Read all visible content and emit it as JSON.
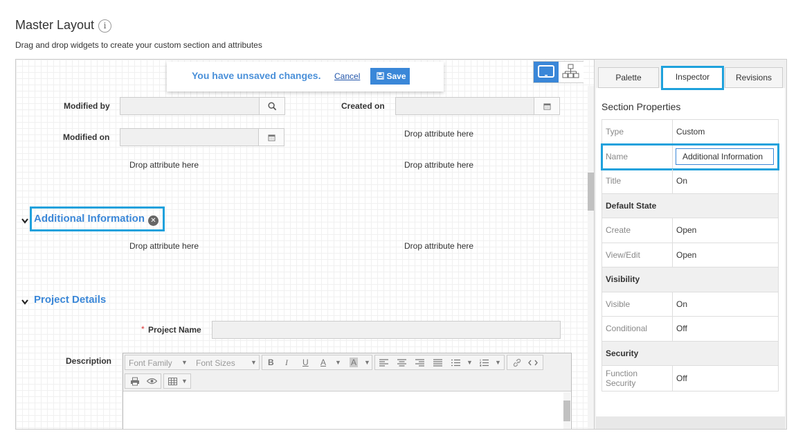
{
  "page": {
    "title": "Master Layout",
    "info_glyph": "i",
    "subtitle": "Drag and drop widgets to create your custom section and attributes"
  },
  "notice": {
    "message": "You have unsaved changes.",
    "cancel": "Cancel",
    "save": "Save"
  },
  "fields": {
    "modified_by": "Modified by",
    "created_on": "Created on",
    "modified_on": "Modified on",
    "drop_text": "Drop attribute here"
  },
  "sections": {
    "additional": "Additional Information",
    "project": "Project Details"
  },
  "project": {
    "required_mark": "*",
    "name_label": "Project Name",
    "description_label": "Description"
  },
  "editor": {
    "font_family": "Font Family",
    "font_sizes": "Font Sizes",
    "bold": "B",
    "italic": "I",
    "underline": "U",
    "font_color": "A",
    "bg_color": "A"
  },
  "panel": {
    "tabs": [
      {
        "label": "Palette"
      },
      {
        "label": "Inspector"
      },
      {
        "label": "Revisions"
      }
    ],
    "active_tab": "Inspector",
    "section_title": "Section Properties",
    "rows": {
      "type": {
        "key": "Type",
        "value": "Custom"
      },
      "name": {
        "key": "Name",
        "value": "Additional Information"
      },
      "title": {
        "key": "Title",
        "value": "On"
      },
      "default_state": "Default State",
      "create": {
        "key": "Create",
        "value": "Open"
      },
      "view_edit": {
        "key": "View/Edit",
        "value": "Open"
      },
      "visibility": "Visibility",
      "visible": {
        "key": "Visible",
        "value": "On"
      },
      "conditional": {
        "key": "Conditional",
        "value": "Off"
      },
      "security": "Security",
      "function_security": {
        "key": "Function Security",
        "value": "Off"
      }
    }
  },
  "colors": {
    "accent": "#3a87d8",
    "highlight": "#1ea1dc",
    "required": "#dd3333"
  }
}
